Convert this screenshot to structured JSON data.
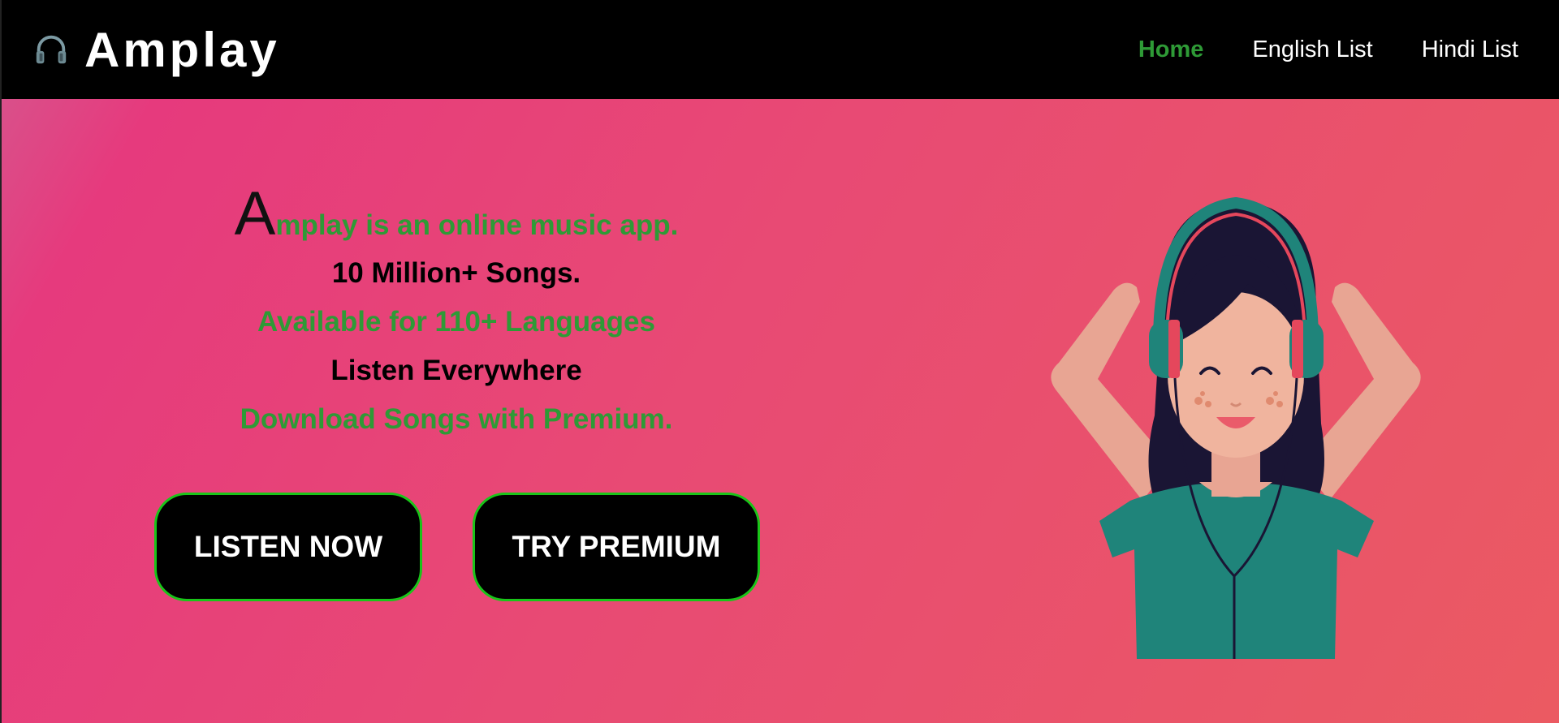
{
  "brand": {
    "name": "Amplay",
    "icon": "headphones-icon"
  },
  "nav": {
    "items": [
      {
        "label": "Home",
        "active": true
      },
      {
        "label": "English List",
        "active": false
      },
      {
        "label": "Hindi List",
        "active": false
      }
    ]
  },
  "hero": {
    "first_letter": "A",
    "first_rest": "mplay is an online music app.",
    "lines": [
      "10 Million+ Songs.",
      "Available for 110+ Languages",
      "Listen Everywhere",
      "Download Songs with Premium."
    ],
    "buttons": {
      "listen": "LISTEN NOW",
      "premium": "TRY PREMIUM"
    },
    "illustration": "girl-with-headphones-illustration"
  },
  "colors": {
    "accent_green": "#2e9a36",
    "button_border": "#19c519",
    "nav_bg": "#000000",
    "gradient_start": "#e63a7d",
    "gradient_end": "#eb5a62"
  }
}
